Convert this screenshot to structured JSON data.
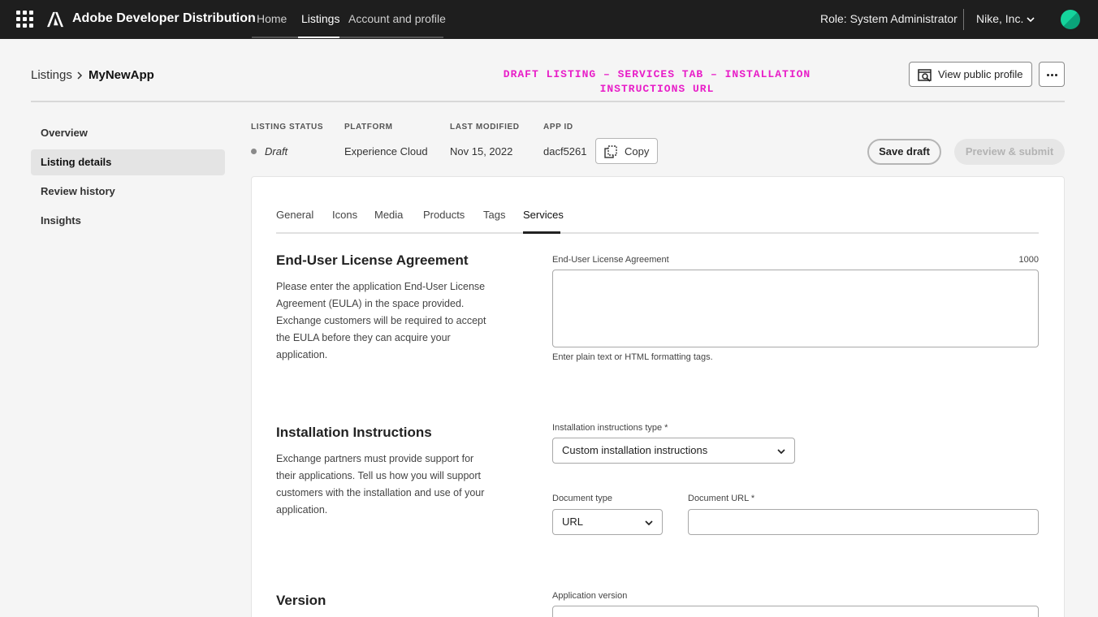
{
  "topbar": {
    "brand": "Adobe Developer Distribution",
    "nav": [
      "Home",
      "Listings",
      "Account and profile"
    ],
    "active_nav": "Listings",
    "role": "Role: System Administrator",
    "org": "Nike, Inc.",
    "avatar_color": "#15d49c"
  },
  "breadcrumb": {
    "parent": "Listings",
    "current": "MyNewApp"
  },
  "annotation": {
    "line1": "DRAFT LISTING – SERVICES TAB – INSTALLATION",
    "line2": "INSTRUCTIONS URL",
    "color": "#e81ec8"
  },
  "header_actions": {
    "view_profile": "View public profile",
    "more_icon": "more-icon"
  },
  "sidebar": {
    "items": [
      {
        "label": "Overview",
        "active": false
      },
      {
        "label": "Listing details",
        "active": true
      },
      {
        "label": "Review history",
        "active": false
      },
      {
        "label": "Insights",
        "active": false
      }
    ]
  },
  "meta": {
    "status_label": "LISTING STATUS",
    "status_value": "Draft",
    "platform_label": "PLATFORM",
    "platform_value": "Experience Cloud",
    "modified_label": "LAST MODIFIED",
    "modified_value": "Nov 15, 2022",
    "appid_label": "APP ID",
    "appid_value": "dacf5261",
    "copy_label": "Copy"
  },
  "actions": {
    "save_draft": "Save draft",
    "preview_submit": "Preview & submit"
  },
  "tabs": {
    "items": [
      "General",
      "Icons",
      "Media",
      "Products",
      "Tags",
      "Services"
    ],
    "active": "Services"
  },
  "eula": {
    "title": "End-User License Agreement",
    "description": "Please enter the application End-User License Agreement (EULA) in the space provided. Exchange customers will be required to accept the EULA before they can acquire your application.",
    "field_label": "End-User License Agreement",
    "counter": "1000",
    "value": "",
    "help": "Enter plain text or HTML formatting tags."
  },
  "installation": {
    "title": "Installation Instructions",
    "description": "Exchange partners must provide support for their applications. Tell us how you will support customers with the installation and use of your application.",
    "type_label": "Installation instructions type *",
    "type_value": "Custom installation instructions",
    "doc_type_label": "Document type",
    "doc_type_value": "URL",
    "doc_url_label": "Document URL *",
    "doc_url_value": ""
  },
  "version": {
    "title": "Version",
    "field_label": "Application version",
    "value": ""
  }
}
